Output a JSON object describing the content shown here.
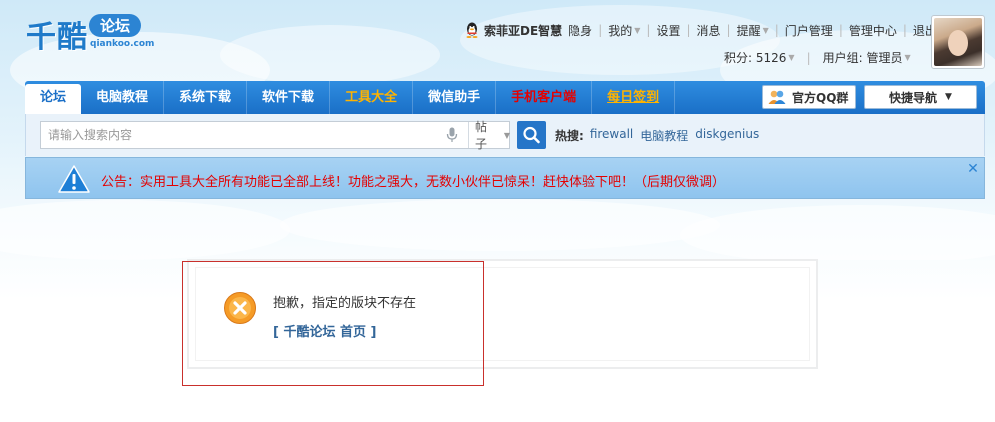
{
  "logo": {
    "main": "千酷",
    "badge": "论坛",
    "sub": "qiankoo.com"
  },
  "userbar": {
    "username": "索菲亚DE智慧",
    "links": [
      "隐身",
      "我的",
      "设置",
      "消息",
      "提醒",
      "门户管理",
      "管理中心",
      "退出"
    ],
    "points_label": "积分: 5126",
    "group_label": "用户组: 管理员"
  },
  "nav": {
    "items": [
      "论坛",
      "电脑教程",
      "系统下载",
      "软件下载",
      "工具大全",
      "微信助手",
      "手机客户端",
      "每日签到"
    ],
    "qq_group": "官方QQ群",
    "quick_nav": "快捷导航"
  },
  "search": {
    "placeholder": "请输入搜索内容",
    "type": "帖子",
    "hot_label": "热搜:",
    "hot_terms": [
      "firewall",
      "电脑教程",
      "diskgenius"
    ]
  },
  "notice": {
    "text": "公告：实用工具大全所有功能已全部上线！功能之强大，无数小伙伴已惊呆！赶快体验下吧！（后期仅微调）"
  },
  "message": {
    "text": "抱歉，指定的版块不存在",
    "link": "[ 千酷论坛 首页 ]"
  },
  "colors": {
    "nav_blue": "#1a6fc7",
    "notice_bg": "#99c9f0",
    "notice_text": "#e40000",
    "link": "#336699",
    "error_orange": "#f59b26"
  }
}
